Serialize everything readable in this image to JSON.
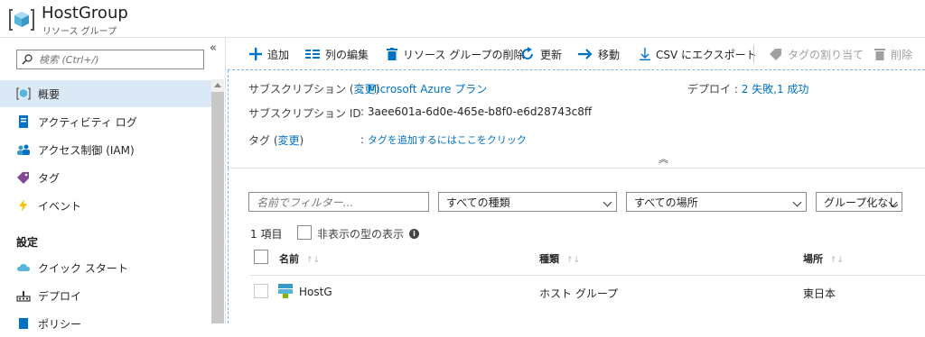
{
  "header": {
    "title": "HostGroup",
    "subtitle": "リソース グループ"
  },
  "sidebar": {
    "search_placeholder": "検索 (Ctrl+/)",
    "collapse_glyph": "«",
    "items": [
      {
        "label": "概要",
        "icon": "resource-group-icon",
        "active": true
      },
      {
        "label": "アクティビティ ログ",
        "icon": "activity-log-icon"
      },
      {
        "label": "アクセス制御 (IAM)",
        "icon": "people-icon"
      },
      {
        "label": "タグ",
        "icon": "tag-icon"
      },
      {
        "label": "イベント",
        "icon": "lightning-icon"
      }
    ],
    "section_label": "設定",
    "settings_items": [
      {
        "label": "クイック スタート",
        "icon": "cloud-icon"
      },
      {
        "label": "デプロイ",
        "icon": "deploy-icon"
      },
      {
        "label": "ポリシー",
        "icon": "policy-icon"
      }
    ]
  },
  "toolbar": {
    "add": "追加",
    "edit_columns": "列の編集",
    "delete_group": "リソース グループの削除",
    "refresh": "更新",
    "move": "移動",
    "export_csv": "CSV にエクスポート",
    "assign_tags": "タグの割り当て",
    "delete": "削除"
  },
  "essentials": {
    "subscription_label": "サブスクリプション (",
    "change_link": "変更",
    "close_paren": ")",
    "subscription_value": "Microsoft Azure プラン",
    "subscription_id_label": "サブスクリプション ID",
    "subscription_id_value": "3aee601a-6d0e-465e-b8f0-e6d28743c8ff",
    "tags_label": "タグ (",
    "tags_change_link": "変更",
    "tags_close_paren": ")",
    "tags_value": "タグを追加するにはここをクリック",
    "deploy_label": "デプロイ",
    "deploy_value": "2 失敗,1 成功",
    "colon": ":"
  },
  "list": {
    "filter_placeholder": "名前でフィルター...",
    "type_filter": "すべての種類",
    "location_filter": "すべての場所",
    "group_filter": "グループ化なし",
    "count": "1 項目",
    "show_hidden": "非表示の型の表示",
    "columns": {
      "name": "名前",
      "type": "種類",
      "location": "場所"
    },
    "sort_glyph": "↑↓",
    "rows": [
      {
        "name": "HostG",
        "type": "ホスト グループ",
        "location": "東日本"
      }
    ]
  }
}
